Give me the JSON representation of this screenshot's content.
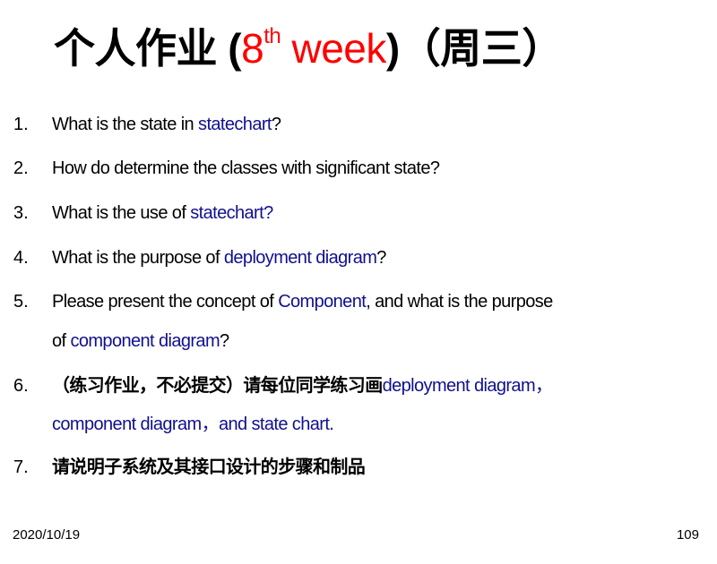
{
  "title": {
    "prefix": "个人作业 (",
    "ordinal": "8",
    "sup": "th",
    "week": " week",
    "suffix": ")（周三）"
  },
  "items": [
    {
      "num": "1.",
      "lines": [
        [
          {
            "t": "What is the state in ",
            "b": false
          },
          {
            "t": "statechart",
            "b": true
          },
          {
            "t": "?",
            "b": false
          }
        ]
      ]
    },
    {
      "num": "2.",
      "lines": [
        [
          {
            "t": "How do determine the classes with significant state?",
            "b": false
          }
        ]
      ]
    },
    {
      "num": "3.",
      "lines": [
        [
          {
            "t": "What is the use of ",
            "b": false
          },
          {
            "t": "statechart?",
            "b": true
          }
        ]
      ]
    },
    {
      "num": "4.",
      "lines": [
        [
          {
            "t": "What is the purpose of ",
            "b": false
          },
          {
            "t": "deployment diagram",
            "b": true
          },
          {
            "t": "?",
            "b": false
          }
        ]
      ]
    },
    {
      "num": "5.",
      "lines": [
        [
          {
            "t": "Please present the concept of ",
            "b": false
          },
          {
            "t": "Component",
            "b": true
          },
          {
            "t": ", and what is the purpose",
            "b": false
          }
        ],
        [
          {
            "t": "of ",
            "b": false
          },
          {
            "t": "component diagram",
            "b": true
          },
          {
            "t": "?",
            "b": false
          }
        ]
      ]
    },
    {
      "num": "6.",
      "lines": [
        [
          {
            "t": "（练习作业，不必提交）请每位同学练习画",
            "b": false
          },
          {
            "t": "deployment diagram，",
            "b": true
          }
        ],
        [
          {
            "t": "component diagram，and state chart.",
            "b": true
          }
        ]
      ]
    },
    {
      "num": "7.",
      "lines": [
        [
          {
            "t": "请说明子系统及其接口设计的步骤和制品",
            "b": false
          }
        ]
      ]
    }
  ],
  "footer": {
    "date": "2020/10/19",
    "page": "109"
  },
  "colors": {
    "accent_red": "#ff0000",
    "link_blue": "#10108f"
  }
}
